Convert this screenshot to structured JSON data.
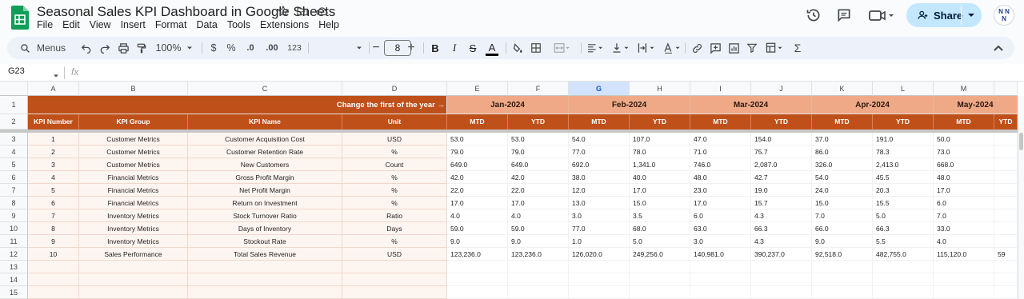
{
  "title_bar": {
    "doc_title": "Seasonal Sales KPI Dashboard in Google Sheets",
    "menu": [
      "File",
      "Edit",
      "View",
      "Insert",
      "Format",
      "Data",
      "Tools",
      "Extensions",
      "Help"
    ],
    "share_label": "Share",
    "avatar_text": "NN\nN"
  },
  "toolbar": {
    "menus_label": "Menus",
    "zoom": "100%",
    "currency": "$",
    "percent": "%",
    "decrease_decimal": ".0",
    "increase_decimal": ".00",
    "number_format": "123",
    "font_size": "8"
  },
  "formula_bar": {
    "cell_ref": "G23",
    "fx": "fx",
    "content": ""
  },
  "grid": {
    "columns": [
      "A",
      "B",
      "C",
      "D",
      "E",
      "F",
      "G",
      "H",
      "I",
      "J",
      "K",
      "L",
      "M"
    ],
    "selected_column": "G",
    "row_numbers": [
      "1",
      "2",
      "3",
      "4",
      "5",
      "6",
      "7",
      "8",
      "9",
      "10",
      "11",
      "12",
      "13",
      "14",
      "15"
    ],
    "header_row1_label": "Change the first of the year →",
    "months": [
      "Jan-2024",
      "Feb-2024",
      "Mar-2024",
      "Apr-2024",
      "May-2024"
    ],
    "kpi_headers": [
      "KPI Number",
      "KPI Group",
      "KPI Name",
      "Unit"
    ],
    "mtd_label": "MTD",
    "ytd_label": "YTD",
    "rows": [
      {
        "num": "1",
        "group": "Customer Metrics",
        "name": "Customer Acquisition Cost",
        "unit": "USD",
        "values": [
          "53.0",
          "53.0",
          "54.0",
          "107.0",
          "47.0",
          "154.0",
          "37.0",
          "191.0",
          "50.0"
        ]
      },
      {
        "num": "2",
        "group": "Customer Metrics",
        "name": "Customer Retention Rate",
        "unit": "%",
        "values": [
          "79.0",
          "79.0",
          "77.0",
          "78.0",
          "71.0",
          "75.7",
          "86.0",
          "78.3",
          "73.0"
        ]
      },
      {
        "num": "3",
        "group": "Customer Metrics",
        "name": "New Customers",
        "unit": "Count",
        "values": [
          "649.0",
          "649.0",
          "692.0",
          "1,341.0",
          "746.0",
          "2,087.0",
          "326.0",
          "2,413.0",
          "668.0"
        ]
      },
      {
        "num": "4",
        "group": "Financial Metrics",
        "name": "Gross Profit Margin",
        "unit": "%",
        "values": [
          "42.0",
          "42.0",
          "38.0",
          "40.0",
          "48.0",
          "42.7",
          "54.0",
          "45.5",
          "48.0"
        ]
      },
      {
        "num": "5",
        "group": "Financial Metrics",
        "name": "Net Profit Margin",
        "unit": "%",
        "values": [
          "22.0",
          "22.0",
          "12.0",
          "17.0",
          "23.0",
          "19.0",
          "24.0",
          "20.3",
          "17.0"
        ]
      },
      {
        "num": "6",
        "group": "Financial Metrics",
        "name": "Return on Investment",
        "unit": "%",
        "values": [
          "17.0",
          "17.0",
          "13.0",
          "15.0",
          "17.0",
          "15.7",
          "15.0",
          "15.5",
          "6.0"
        ]
      },
      {
        "num": "7",
        "group": "Inventory Metrics",
        "name": "Stock Turnover Ratio",
        "unit": "Ratio",
        "values": [
          "4.0",
          "4.0",
          "3.0",
          "3.5",
          "6.0",
          "4.3",
          "7.0",
          "5.0",
          "7.0"
        ]
      },
      {
        "num": "8",
        "group": "Inventory Metrics",
        "name": "Days of Inventory",
        "unit": "Days",
        "values": [
          "59.0",
          "59.0",
          "77.0",
          "68.0",
          "63.0",
          "66.3",
          "66.0",
          "66.3",
          "33.0"
        ]
      },
      {
        "num": "9",
        "group": "Inventory Metrics",
        "name": "Stockout Rate",
        "unit": "%",
        "values": [
          "9.0",
          "9.0",
          "1.0",
          "5.0",
          "3.0",
          "4.3",
          "9.0",
          "5.5",
          "4.0"
        ]
      },
      {
        "num": "10",
        "group": "Sales Performance",
        "name": "Total Sales Revenue",
        "unit": "USD",
        "values": [
          "123,236.0",
          "123,236.0",
          "126,020.0",
          "249,256.0",
          "140,981.0",
          "390,237.0",
          "92,518.0",
          "482,755.0",
          "115,120.0"
        ]
      }
    ],
    "overflow_text": "59"
  },
  "colors": {
    "header_dark": "#c0501a",
    "header_month": "#f0a987",
    "kpi_bg": "#fdf5f0",
    "share_bg": "#c2e7ff"
  }
}
